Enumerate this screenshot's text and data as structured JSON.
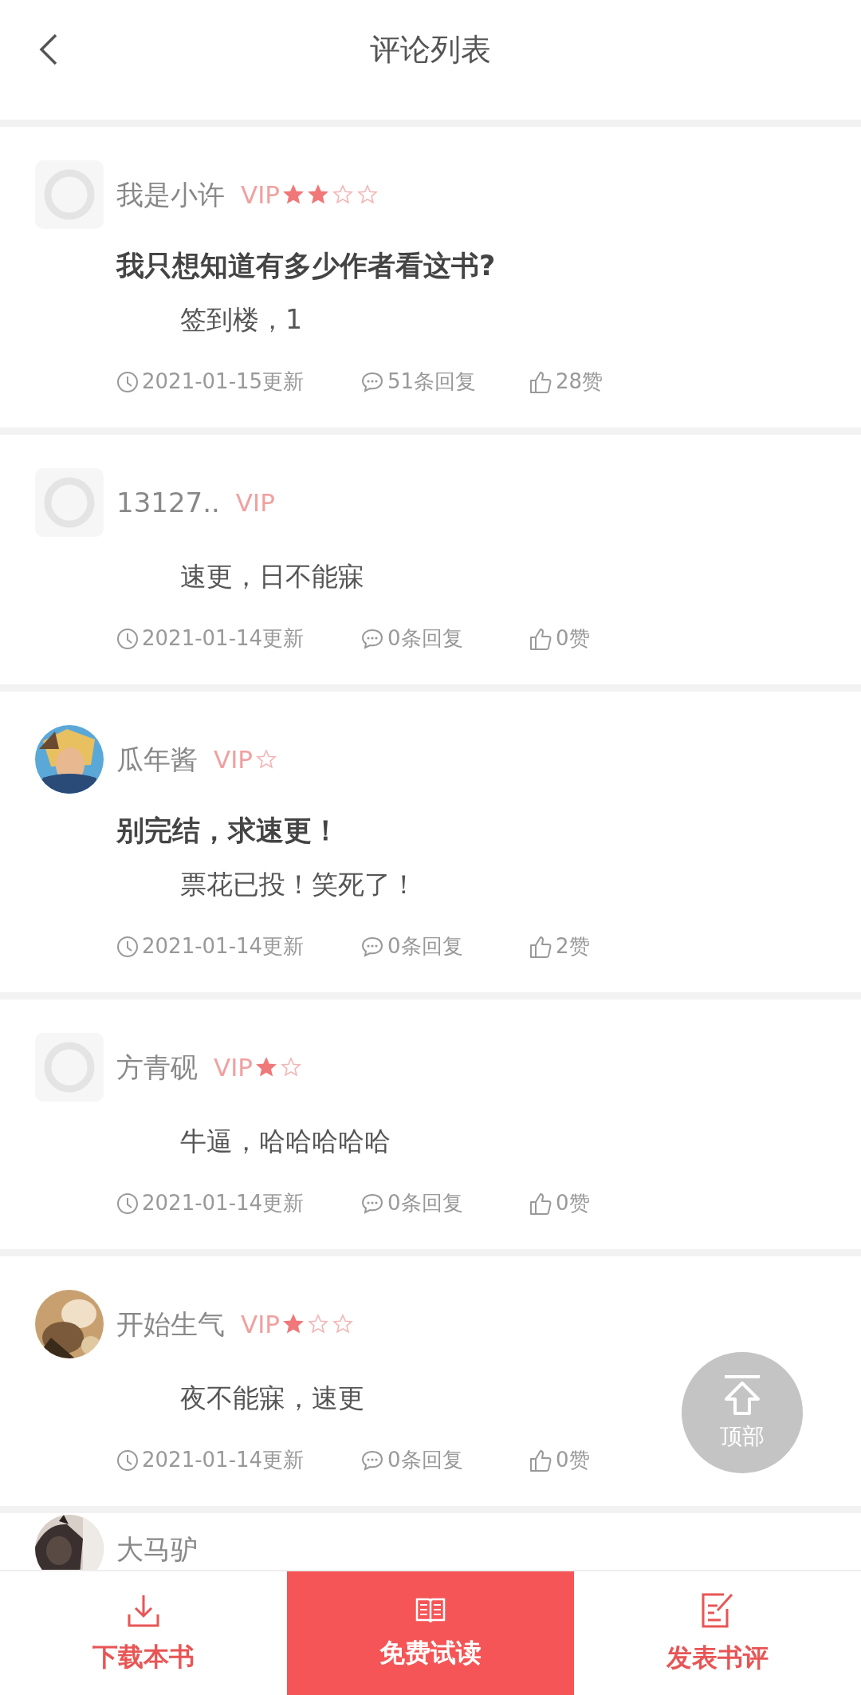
{
  "header": {
    "title": "评论列表"
  },
  "comments": [
    {
      "photo_avatar": false,
      "name": "我是小许",
      "badge": "VIP",
      "rank_stars": [
        {
          "filled": true
        },
        {
          "filled": true
        },
        {
          "filled": false
        },
        {
          "filled": false
        }
      ],
      "title": "我只想知道有多少作者看这书?",
      "body": "签到楼，1",
      "date": "2021-01-15更新",
      "replies": "51条回复",
      "likes": "28赞"
    },
    {
      "photo_avatar": false,
      "name": "13127..",
      "badge": "VIP",
      "body": "速更，日不能寐",
      "date": "2021-01-14更新",
      "replies": "0条回复",
      "likes": "0赞"
    },
    {
      "photo_avatar": true,
      "name": "瓜年酱",
      "badge": "VIP",
      "rank_stars": [
        {
          "filled": false
        }
      ],
      "title": "别完结，求速更！",
      "body": "票花已投！笑死了！",
      "date": "2021-01-14更新",
      "replies": "0条回复",
      "likes": "2赞"
    },
    {
      "photo_avatar": false,
      "name": "方青砚",
      "badge": "VIP",
      "rank_stars": [
        {
          "filled": true
        },
        {
          "filled": false
        }
      ],
      "body": "牛逼，哈哈哈哈哈",
      "date": "2021-01-14更新",
      "replies": "0条回复",
      "likes": "0赞"
    },
    {
      "photo_avatar": true,
      "name": "开始生气",
      "badge": "VIP",
      "rank_stars": [
        {
          "filled": true
        },
        {
          "filled": false
        },
        {
          "filled": false
        }
      ],
      "body": "夜不能寐，速更",
      "date": "2021-01-14更新",
      "replies": "0条回复",
      "likes": "0赞"
    }
  ],
  "partial_comment": {
    "photo_avatar": true,
    "name": "大马驴"
  },
  "back_to_top": {
    "label": "顶部"
  },
  "bottom_bar": [
    {
      "label": "下载本书",
      "kind": "download",
      "highlighted": false
    },
    {
      "label": "免费试读",
      "kind": "read",
      "highlighted": true
    },
    {
      "label": "发表书评",
      "kind": "review",
      "highlighted": false
    }
  ]
}
